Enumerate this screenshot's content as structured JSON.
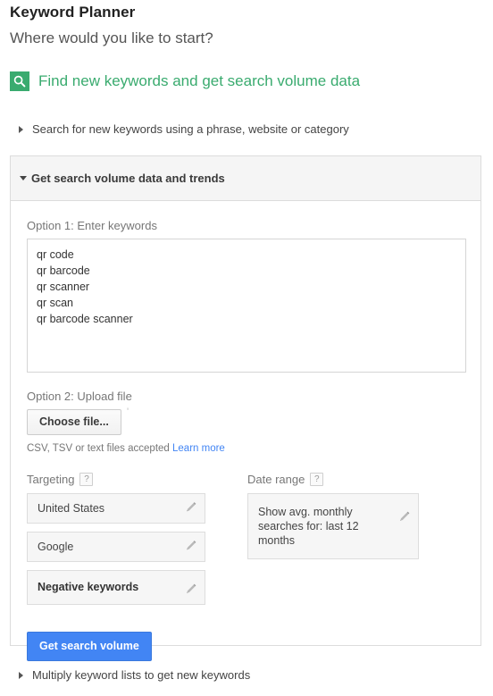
{
  "header": {
    "app_title": "Keyword Planner",
    "subtitle": "Where would you like to start?"
  },
  "green_section": {
    "icon": "search-icon",
    "label": "Find new keywords and get search volume data",
    "color": "#3aab6f"
  },
  "sections": [
    {
      "id": "search-new-keywords",
      "label": "Search for new keywords using a phrase, website or category",
      "expanded": false,
      "caret": "triangle-right"
    },
    {
      "id": "get-search-volume",
      "label": "Get search volume data and trends",
      "expanded": true,
      "caret": "triangle-down"
    },
    {
      "id": "multiply-keyword-lists",
      "label": "Multiply keyword lists to get new keywords",
      "expanded": false,
      "caret": "triangle-right"
    }
  ],
  "form": {
    "option1": {
      "label": "Option 1: Enter keywords",
      "keywords": [
        "qr code",
        "qr barcode",
        "qr scanner",
        "qr scan",
        "qr barcode scanner"
      ],
      "keywords_value": "qr code\nqr barcode\nqr scanner\nqr scan\nqr barcode scanner"
    },
    "option2": {
      "label": "Option 2: Upload file",
      "choose_file_label": "Choose file...",
      "file_artifact": "'",
      "hint_text": "CSV, TSV or text files accepted",
      "hint_link": "Learn more"
    },
    "targeting": {
      "label": "Targeting",
      "help_glyph": "?",
      "items": [
        {
          "value": "United States",
          "bold": false,
          "edit_icon": "pencil-icon"
        },
        {
          "value": "Google",
          "bold": false,
          "edit_icon": "pencil-icon"
        },
        {
          "value": "Negative keywords",
          "bold": true,
          "edit_icon": "pencil-icon"
        }
      ]
    },
    "date_range": {
      "label": "Date range",
      "help_glyph": "?",
      "value": "Show avg. monthly searches for: last 12 months",
      "edit_icon": "pencil-icon"
    },
    "submit": {
      "label": "Get search volume",
      "color": "#4285f4"
    }
  }
}
